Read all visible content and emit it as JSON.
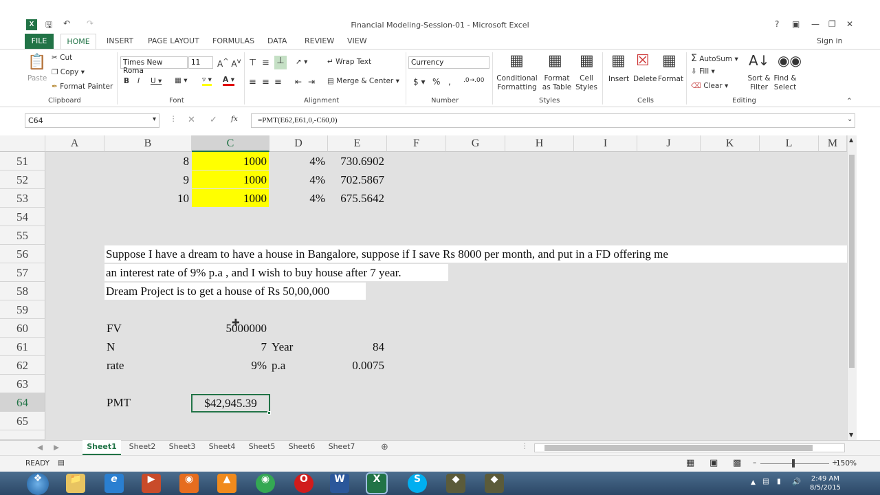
{
  "window": {
    "title": "Financial Modeling-Session-01 - Microsoft Excel",
    "sign_in": "Sign in"
  },
  "tabs": [
    "FILE",
    "HOME",
    "INSERT",
    "PAGE LAYOUT",
    "FORMULAS",
    "DATA",
    "REVIEW",
    "VIEW"
  ],
  "ribbon": {
    "clipboard": {
      "paste": "Paste",
      "cut": "Cut",
      "copy": "Copy",
      "format_painter": "Format Painter",
      "label": "Clipboard"
    },
    "font": {
      "name": "Times New Roma",
      "size": "11",
      "label": "Font"
    },
    "alignment": {
      "wrap_text": "Wrap Text",
      "merge_center": "Merge & Center",
      "label": "Alignment"
    },
    "number": {
      "format": "Currency",
      "label": "Number"
    },
    "styles": {
      "conditional": "Conditional Formatting",
      "format_as": "Format as Table",
      "cell_styles": "Cell Styles",
      "label": "Styles"
    },
    "cells": {
      "insert": "Insert",
      "delete": "Delete",
      "format": "Format",
      "label": "Cells"
    },
    "editing": {
      "autosum": "AutoSum",
      "fill": "Fill",
      "clear": "Clear",
      "sort_filter": "Sort & Filter",
      "find_select": "Find & Select",
      "label": "Editing"
    }
  },
  "formula_bar": {
    "name_box": "C64",
    "formula": "=PMT(E62,E61,0,-C60,0)"
  },
  "columns": [
    "A",
    "B",
    "C",
    "D",
    "E",
    "F",
    "G",
    "H",
    "I",
    "J",
    "K",
    "L"
  ],
  "rows": [
    {
      "num": "51",
      "B": "8",
      "C": "1000",
      "D": "4%",
      "E": "730.6902"
    },
    {
      "num": "52",
      "B": "9",
      "C": "1000",
      "D": "4%",
      "E": "702.5867"
    },
    {
      "num": "53",
      "B": "10",
      "C": "1000",
      "D": "4%",
      "E": "675.5642"
    },
    {
      "num": "54"
    },
    {
      "num": "55"
    },
    {
      "num": "56",
      "B": "Suppose I have a dream to have a house in Bangalore, suppose if I save Rs 8000 per month, and put in a FD offering me"
    },
    {
      "num": "57",
      "B": "an interest rate of 9% p.a , and I wish to buy house after 7 year."
    },
    {
      "num": "58",
      "B": "Dream Project is to get a house of Rs 50,00,000"
    },
    {
      "num": "59"
    },
    {
      "num": "60",
      "B": "FV",
      "C": "5000000"
    },
    {
      "num": "61",
      "B": "N",
      "C": "7",
      "D": "Year",
      "E": "84"
    },
    {
      "num": "62",
      "B": "rate",
      "C": "9%",
      "D": "p.a",
      "E": "0.0075"
    },
    {
      "num": "63"
    },
    {
      "num": "64",
      "B": "PMT",
      "C": "$42,945.39"
    },
    {
      "num": "65"
    }
  ],
  "sheets": [
    "Sheet1",
    "Sheet2",
    "Sheet3",
    "Sheet4",
    "Sheet5",
    "Sheet6",
    "Sheet7"
  ],
  "status": {
    "mode": "READY",
    "zoom": "150%"
  },
  "clock": {
    "time": "2:49 AM",
    "date": "8/5/2015"
  },
  "colors": {
    "accent": "#217346",
    "highlight": "#ffff00"
  }
}
